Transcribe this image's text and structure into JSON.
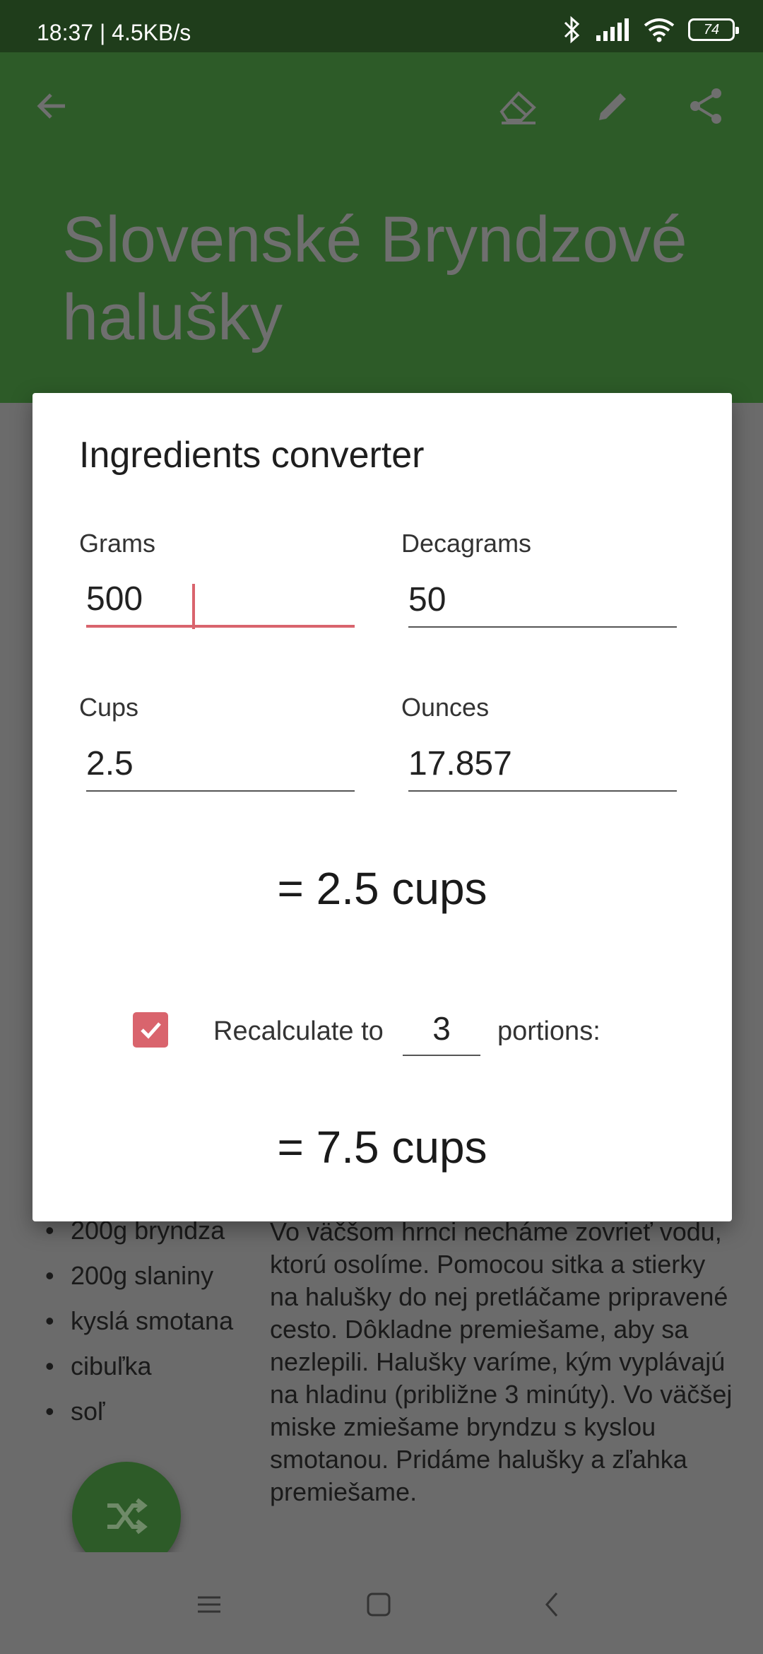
{
  "status_bar": {
    "time_speed": "18:37 | 4.5KB/s",
    "battery": "74"
  },
  "app_bar": {
    "title": "Slovenské Bryndzové halušky",
    "color": "#2d5b28"
  },
  "ingredients": [
    "200g bryndza",
    "200g slaniny",
    "kyslá smotana",
    "cibuľka",
    "soľ"
  ],
  "method_text": "Vo väčšom hrnci necháme zovrieť vodu, ktorú osolíme. Pomocou sitka a stierky na halušky do nej pretláčame pripravené cesto. Dôkladne premiešame, aby sa nezlepili. Halušky varíme, kým vyplávajú na hladinu (približne 3 minúty). Vo väčšej miske zmiešame bryndzu s kyslou smotanou. Pridáme halušky a zľahka premiešame.",
  "dialog": {
    "title": "Ingredients converter",
    "fields": {
      "grams": {
        "label": "Grams",
        "value": "500"
      },
      "decagrams": {
        "label": "Decagrams",
        "value": "50"
      },
      "cups": {
        "label": "Cups",
        "value": "2.5"
      },
      "ounces": {
        "label": "Ounces",
        "value": "17.857"
      }
    },
    "result_1": "= 2.5 cups",
    "recalc": {
      "checked": true,
      "label_before": "Recalculate to",
      "portions_value": "3",
      "label_after": "portions:"
    },
    "result_2": "= 7.5 cups",
    "accent_color": "#d9646d"
  },
  "icons": {
    "back": "arrow-back-icon",
    "eraser": "eraser-icon",
    "edit": "pencil-icon",
    "share": "share-icon",
    "fab": "shuffle-icon",
    "nav_menu": "menu-icon",
    "nav_home": "home-icon",
    "nav_back": "nav-back-icon"
  }
}
